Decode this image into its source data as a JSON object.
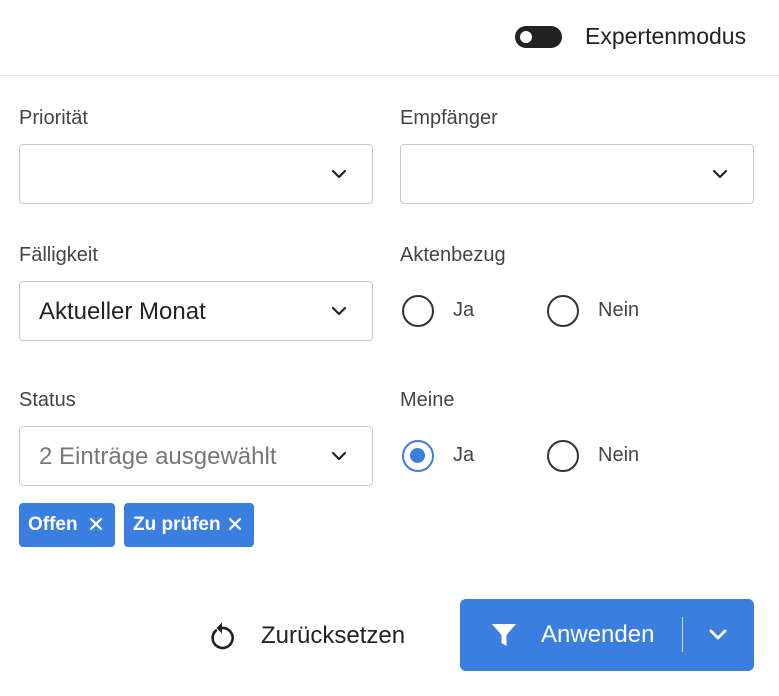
{
  "header": {
    "expert_mode_label": "Expertenmodus",
    "expert_mode_on": false
  },
  "filters": {
    "prioritaet": {
      "label": "Priorität",
      "value": ""
    },
    "empfaenger": {
      "label": "Empfänger",
      "value": ""
    },
    "faelligkeit": {
      "label": "Fälligkeit",
      "value": "Aktueller Monat"
    },
    "aktenbezug": {
      "label": "Aktenbezug",
      "options": [
        {
          "label": "Ja",
          "checked": false
        },
        {
          "label": "Nein",
          "checked": false
        }
      ]
    },
    "status": {
      "label": "Status",
      "placeholder": "2 Einträge ausgewählt",
      "chips": [
        {
          "label": "Offen"
        },
        {
          "label": "Zu prüfen"
        }
      ]
    },
    "meine": {
      "label": "Meine",
      "options": [
        {
          "label": "Ja",
          "checked": true
        },
        {
          "label": "Nein",
          "checked": false
        }
      ]
    }
  },
  "actions": {
    "reset_label": "Zurücksetzen",
    "apply_label": "Anwenden"
  },
  "colors": {
    "accent": "#3a7fe0",
    "toggle_off": "#222222",
    "text": "#222222"
  },
  "icons": {
    "toggle": "toggle-switch-icon",
    "dropdown": "chevron-down-icon",
    "chip_remove": "close-icon",
    "reset": "reset-rotate-icon",
    "apply": "filter-funnel-icon",
    "apply_menu": "chevron-down-icon"
  }
}
